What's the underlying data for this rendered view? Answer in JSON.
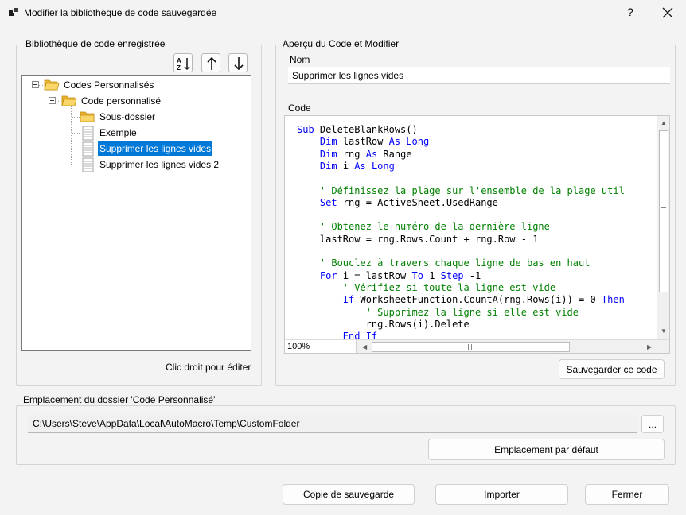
{
  "window": {
    "title": "Modifier la bibliothèque de code sauvegardée",
    "help_label": "?"
  },
  "library": {
    "group_label": "Bibliothèque de code enregistrée",
    "tools": [
      "sort-az-icon",
      "arrow-up-icon",
      "arrow-down-icon"
    ],
    "tree": [
      {
        "label": "Codes Personnalisés",
        "type": "folder",
        "level": 0
      },
      {
        "label": "Code personnalisé",
        "type": "folder",
        "level": 1
      },
      {
        "label": "Sous-dossier",
        "type": "folder",
        "level": 2
      },
      {
        "label": "Exemple",
        "type": "file",
        "level": 2
      },
      {
        "label": "Supprimer les lignes vides",
        "type": "file",
        "level": 2,
        "selected": true
      },
      {
        "label": "Supprimer les lignes vides 2",
        "type": "file",
        "level": 2
      }
    ],
    "hint": "Clic droit pour éditer"
  },
  "preview": {
    "group_label": "Aperçu du Code et Modifier",
    "name_label": "Nom",
    "name_value": "Supprimer les lignes vides",
    "code_label": "Code",
    "zoom": "100%",
    "save_button": "Sauvegarder ce code",
    "code_lines": [
      [
        {
          "t": "kw",
          "v": "Sub "
        },
        {
          "t": "tx",
          "v": "DeleteBlankRows()"
        }
      ],
      [
        {
          "t": "tx",
          "v": "    "
        },
        {
          "t": "kw",
          "v": "Dim "
        },
        {
          "t": "tx",
          "v": "lastRow "
        },
        {
          "t": "kw",
          "v": "As Long"
        }
      ],
      [
        {
          "t": "tx",
          "v": "    "
        },
        {
          "t": "kw",
          "v": "Dim "
        },
        {
          "t": "tx",
          "v": "rng "
        },
        {
          "t": "kw",
          "v": "As "
        },
        {
          "t": "tx",
          "v": "Range"
        }
      ],
      [
        {
          "t": "tx",
          "v": "    "
        },
        {
          "t": "kw",
          "v": "Dim "
        },
        {
          "t": "tx",
          "v": "i "
        },
        {
          "t": "kw",
          "v": "As Long"
        }
      ],
      [],
      [
        {
          "t": "cm",
          "v": "    ' Définissez la plage sur l'ensemble de la plage util"
        }
      ],
      [
        {
          "t": "tx",
          "v": "    "
        },
        {
          "t": "kw",
          "v": "Set "
        },
        {
          "t": "tx",
          "v": "rng = ActiveSheet.UsedRange"
        }
      ],
      [],
      [
        {
          "t": "cm",
          "v": "    ' Obtenez le numéro de la dernière ligne"
        }
      ],
      [
        {
          "t": "tx",
          "v": "    lastRow = rng.Rows.Count + rng.Row - 1"
        }
      ],
      [],
      [
        {
          "t": "cm",
          "v": "    ' Bouclez à travers chaque ligne de bas en haut"
        }
      ],
      [
        {
          "t": "tx",
          "v": "    "
        },
        {
          "t": "kw",
          "v": "For "
        },
        {
          "t": "tx",
          "v": "i = lastRow "
        },
        {
          "t": "kw",
          "v": "To "
        },
        {
          "t": "tx",
          "v": "1 "
        },
        {
          "t": "kw",
          "v": "Step "
        },
        {
          "t": "tx",
          "v": "-1"
        }
      ],
      [
        {
          "t": "cm",
          "v": "        ' Vérifiez si toute la ligne est vide"
        }
      ],
      [
        {
          "t": "tx",
          "v": "        "
        },
        {
          "t": "kw",
          "v": "If "
        },
        {
          "t": "tx",
          "v": "WorksheetFunction.CountA(rng.Rows(i)) = 0 "
        },
        {
          "t": "kw",
          "v": "Then"
        }
      ],
      [
        {
          "t": "cm",
          "v": "            ' Supprimez la ligne si elle est vide"
        }
      ],
      [
        {
          "t": "tx",
          "v": "            rng.Rows(i).Delete"
        }
      ],
      [
        {
          "t": "tx",
          "v": "        "
        },
        {
          "t": "kw",
          "v": "End If"
        }
      ]
    ]
  },
  "folder": {
    "group_label": "Emplacement du dossier 'Code Personnalisé'",
    "path": "C:\\Users\\Steve\\AppData\\Local\\AutoMacro\\Temp\\CustomFolder",
    "browse_button": "...",
    "default_button": "Emplacement par défaut"
  },
  "footer": {
    "backup_button": "Copie de sauvegarde",
    "import_button": "Importer",
    "close_button": "Fermer"
  },
  "colors": {
    "selection": "#0078d7",
    "keyword": "#0000ff",
    "comment": "#008000",
    "folder": "#f6c944"
  }
}
